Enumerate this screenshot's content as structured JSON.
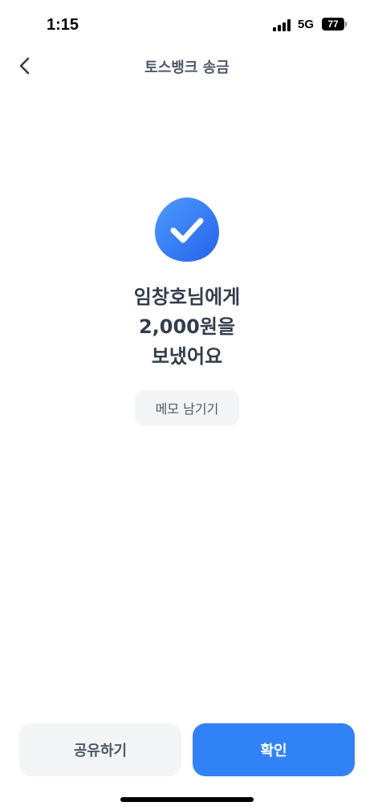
{
  "status_bar": {
    "time": "1:15",
    "network": "5G",
    "battery": "77"
  },
  "nav": {
    "title": "토스뱅크 송금",
    "back_icon": "chevron-left-icon"
  },
  "result": {
    "icon": "check-circle-icon",
    "line1": "임창호님에게",
    "line2": "2,000원을",
    "line3": "보냈어요",
    "memo_label": "메모 남기기"
  },
  "actions": {
    "share_label": "공유하기",
    "confirm_label": "확인"
  },
  "colors": {
    "primary": "#3182f6",
    "secondary_bg": "#f2f4f6",
    "text_dark": "#333d4b",
    "text_gray": "#4e5968"
  }
}
